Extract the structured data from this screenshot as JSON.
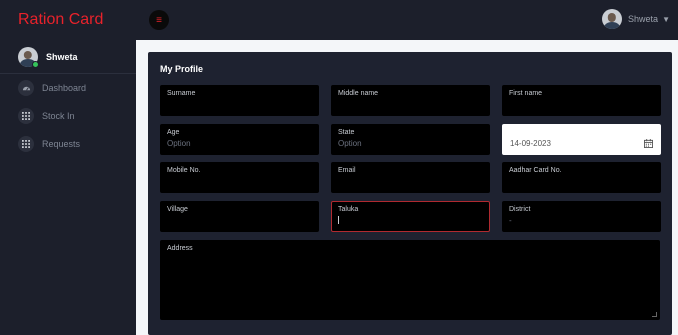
{
  "app": {
    "title": "Ration Card"
  },
  "header": {
    "user_name": "Shweta"
  },
  "sidebar": {
    "user_name": "Shweta",
    "items": [
      {
        "label": "Dashboard",
        "icon": "dashboard-icon"
      },
      {
        "label": "Stock In",
        "icon": "grid-icon"
      },
      {
        "label": "Requests",
        "icon": "grid-icon"
      }
    ]
  },
  "form": {
    "title": "My Profile",
    "surname": {
      "label": "Surname"
    },
    "middle_name": {
      "label": "Middle name"
    },
    "first_name": {
      "label": "First name"
    },
    "age": {
      "label": "Age",
      "value": "Option"
    },
    "state": {
      "label": "State",
      "value": "Option"
    },
    "date": {
      "value": "14-09-2023"
    },
    "mobile": {
      "label": "Mobile No."
    },
    "email": {
      "label": "Email"
    },
    "aadhar": {
      "label": "Aadhar Card No."
    },
    "village": {
      "label": "Village"
    },
    "taluka": {
      "label": "Taluka"
    },
    "district": {
      "label": "District",
      "value": "-"
    },
    "address": {
      "label": "Address"
    }
  },
  "colors": {
    "brand": "#e8222b",
    "panel": "#1c1f2b",
    "card": "#1e2230",
    "field": "#000000",
    "focus_border": "#b02a30",
    "online": "#35c35b"
  }
}
